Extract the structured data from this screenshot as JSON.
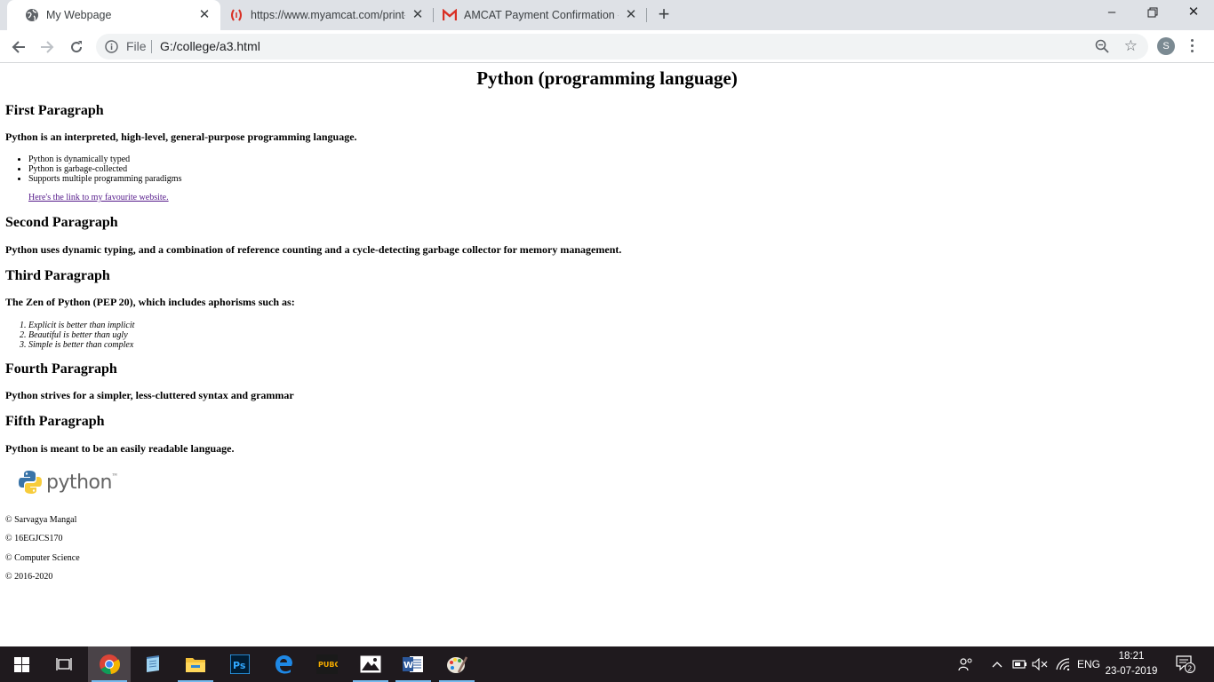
{
  "browser": {
    "tabs": [
      {
        "title": "My Webpage",
        "active": true,
        "favicon": "globe-icon"
      },
      {
        "title": "https://www.myamcat.com/print-",
        "active": false,
        "favicon": "amcat-icon"
      },
      {
        "title": "AMCAT Payment Confirmation - ",
        "active": false,
        "favicon": "gmail-icon"
      }
    ],
    "address": {
      "scheme_label": "File",
      "url": "G:/college/a3.html"
    },
    "profile_initial": "S"
  },
  "page": {
    "title": "Python (programming language)",
    "sections": [
      {
        "heading": "First Paragraph",
        "text": "Python is an interpreted, high-level, general-purpose programming language."
      },
      {
        "heading": "Second Paragraph",
        "text": "Python uses dynamic typing, and a combination of reference counting and a cycle-detecting garbage collector for memory management."
      },
      {
        "heading": "Third Paragraph",
        "text": "The Zen of Python (PEP 20), which includes aphorisms such as:"
      },
      {
        "heading": "Fourth Paragraph",
        "text": "Python strives for a simpler, less-cluttered syntax and grammar"
      },
      {
        "heading": "Fifth Paragraph",
        "text": "Python is meant to be an easily readable language."
      }
    ],
    "bullets": [
      "Python is dynamically typed",
      "Python is garbage-collected",
      "Supports multiple programming paradigms"
    ],
    "link_text": "Here's the link to my favourite website.",
    "zen": [
      "Explicit is better than implicit",
      "Beautiful is better than ugly",
      "Simple is better than complex"
    ],
    "logo_word": "python",
    "logo_tm": "™",
    "footer": [
      "© Sarvagya Mangal",
      "© 16EGJCS170",
      "© Computer Science",
      "© 2016-2020"
    ]
  },
  "taskbar": {
    "apps": [
      "windows-start-icon",
      "task-view-icon",
      "chrome-icon",
      "notepad-icon",
      "file-explorer-icon",
      "photoshop-icon",
      "edge-icon",
      "pubg-icon",
      "photos-icon",
      "word-icon",
      "paint-icon"
    ],
    "language": "ENG",
    "time": "18:21",
    "date": "23-07-2019",
    "notification_count": "2"
  },
  "colors": {
    "tabstrip": "#dee1e6",
    "taskbar": "#1f1a1e",
    "link": "#551a8b",
    "accent": "#76b9ed"
  }
}
